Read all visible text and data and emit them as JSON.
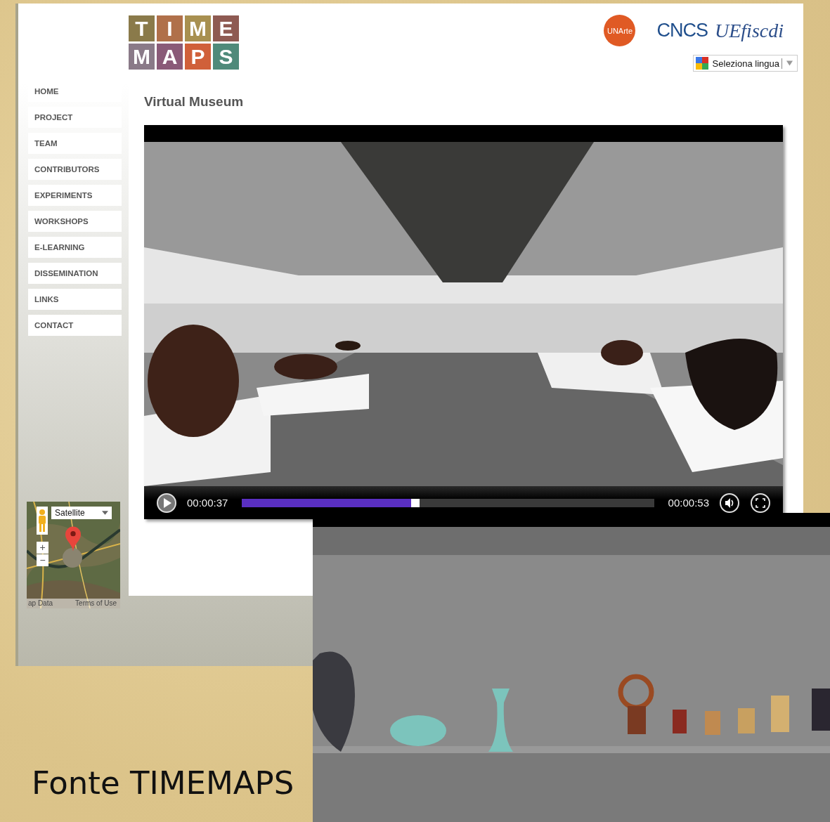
{
  "logo": {
    "tiles": [
      {
        "letter": "T",
        "color": "#8a7a4a"
      },
      {
        "letter": "I",
        "color": "#b0704a"
      },
      {
        "letter": "M",
        "color": "#a89050"
      },
      {
        "letter": "E",
        "color": "#8e5a52"
      },
      {
        "letter": "M",
        "color": "#8a7a88"
      },
      {
        "letter": "A",
        "color": "#8a5a78"
      },
      {
        "letter": "P",
        "color": "#d0603a"
      },
      {
        "letter": "S",
        "color": "#4f8a7a"
      }
    ]
  },
  "partners": [
    {
      "kind": "badge",
      "text": "UNArte"
    },
    {
      "kind": "wordmark",
      "text": "CNCS"
    },
    {
      "kind": "script",
      "text": "UEfiscdi"
    }
  ],
  "language": {
    "label": "Seleziona lingua"
  },
  "nav": [
    {
      "label": "HOME"
    },
    {
      "label": "PROJECT"
    },
    {
      "label": "TEAM"
    },
    {
      "label": "CONTRIBUTORS"
    },
    {
      "label": "EXPERIMENTS"
    },
    {
      "label": "WORKSHOPS"
    },
    {
      "label": "E-LEARNING"
    },
    {
      "label": "DISSEMINATION"
    },
    {
      "label": "LINKS"
    },
    {
      "label": "CONTACT"
    }
  ],
  "page_title": "Virtual Museum",
  "video": {
    "current_time": "00:00:37",
    "duration": "00:00:53",
    "level": 0.42
  },
  "map": {
    "map_type": "Satellite",
    "zoom_in": "+",
    "zoom_out": "−",
    "attribution": [
      "ap Data",
      "Terms of Use"
    ]
  },
  "caption": "Fonte TIMEMAPS"
}
